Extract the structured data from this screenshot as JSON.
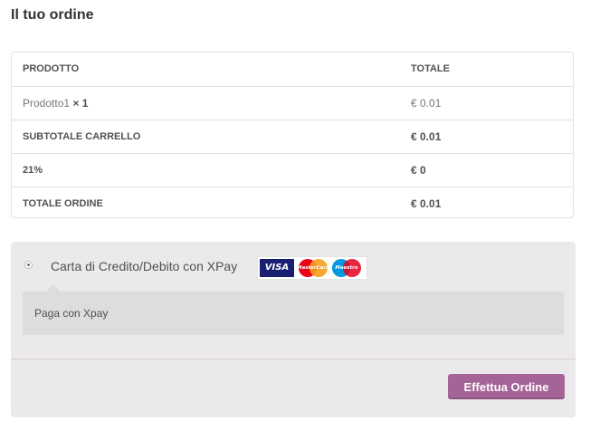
{
  "title": "Il tuo ordine",
  "table": {
    "headers": {
      "product": "PRODOTTO",
      "total": "TOTALE"
    },
    "item": {
      "name": "Prodotto1",
      "qty": "× 1",
      "total": "€ 0.01"
    },
    "subtotal": {
      "label": "SUBTOTALE CARRELLO",
      "value": "€ 0.01"
    },
    "tax": {
      "label": "21%",
      "value": "€ 0"
    },
    "order_total": {
      "label": "TOTALE ORDINE",
      "value": "€ 0.01"
    }
  },
  "payment": {
    "method_label": "Carta di Credito/Debito con XPay",
    "selected": true,
    "card_logos": [
      "VISA",
      "MasterCard",
      "Maestro"
    ],
    "description": "Paga con Xpay"
  },
  "place_order_label": "Effettua Ordine",
  "colors": {
    "accent": "#a46497",
    "box_bg": "#ebe9eb",
    "desc_bg": "#dfdcde"
  }
}
